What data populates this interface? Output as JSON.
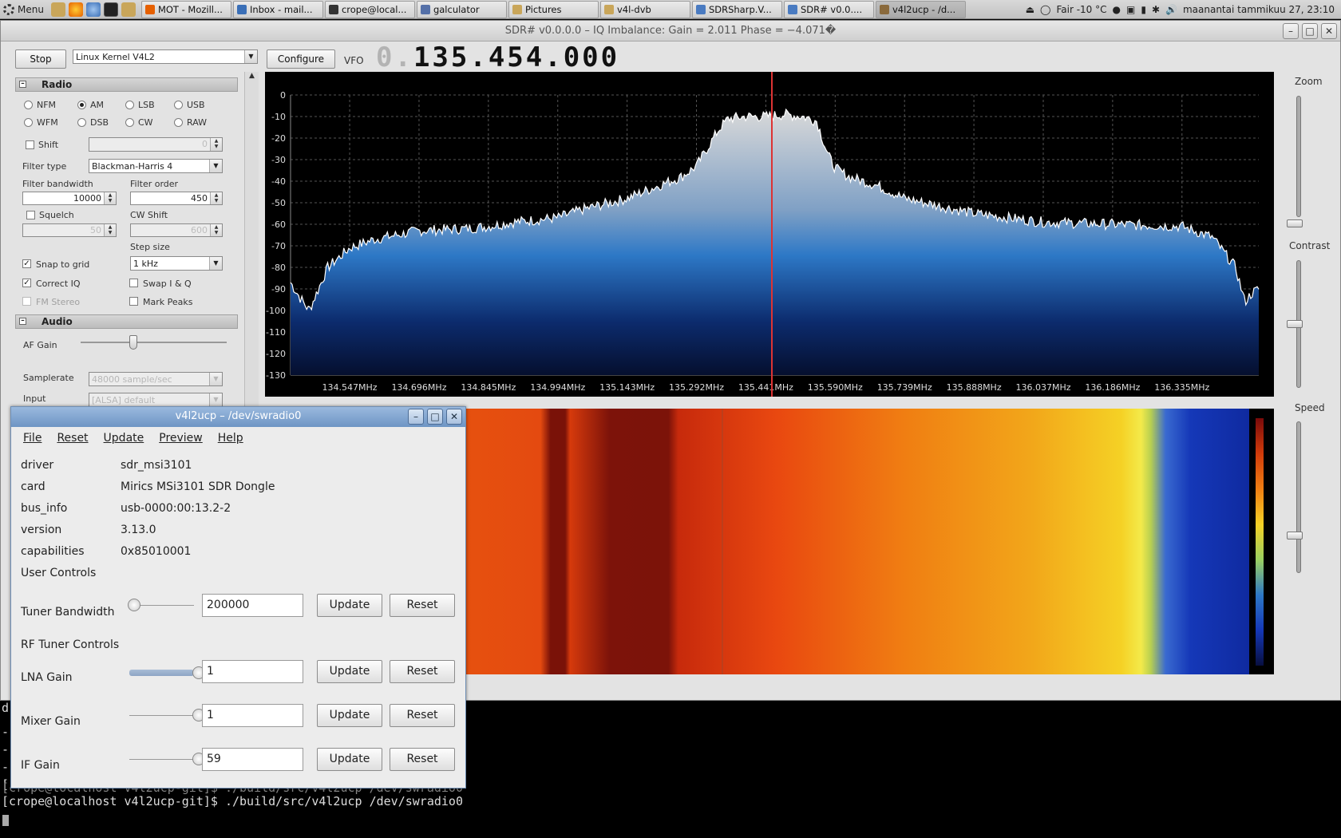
{
  "taskbar": {
    "menu_label": "Menu",
    "tasks": [
      {
        "label": "MOT - Mozill...",
        "color": "#e66000"
      },
      {
        "label": "Inbox - mail...",
        "color": "#3a6fb7"
      },
      {
        "label": "crope@local...",
        "color": "#333333"
      },
      {
        "label": "galculator",
        "color": "#5470a8"
      },
      {
        "label": "Pictures",
        "color": "#c9a65a"
      },
      {
        "label": "v4l-dvb",
        "color": "#c9a65a"
      },
      {
        "label": "SDRSharp.V...",
        "color": "#4a7bc1"
      },
      {
        "label": "SDR# v0.0....",
        "color": "#4a7bc1"
      },
      {
        "label": "v4l2ucp - /d...",
        "color": "#8a6a3c"
      }
    ],
    "weather": "Fair -10 °C",
    "clock": "maanantai tammikuu 27, 23:10"
  },
  "sdr": {
    "title": "SDR# v0.0.0.0 – IQ Imbalance: Gain = 2.011 Phase = −4.071�",
    "stop_label": "Stop",
    "source": "Linux Kernel V4L2",
    "configure_label": "Configure",
    "vfo_label": "VFO",
    "vfo_dim": "0.",
    "vfo_value": "135.454.000",
    "radio_section": "Radio",
    "modes": [
      "NFM",
      "AM",
      "LSB",
      "USB",
      "WFM",
      "DSB",
      "CW",
      "RAW"
    ],
    "selected_mode": "AM",
    "shift_label": "Shift",
    "shift_value": "0",
    "filter_type_label": "Filter type",
    "filter_type": "Blackman-Harris 4",
    "filter_bw_label": "Filter bandwidth",
    "filter_bw": "10000",
    "filter_order_label": "Filter order",
    "filter_order": "450",
    "squelch_label": "Squelch",
    "squelch_value": "50",
    "cw_shift_label": "CW Shift",
    "cw_shift_value": "600",
    "step_size_label": "Step size",
    "step_size": "1 kHz",
    "snap_label": "Snap to grid",
    "correct_iq_label": "Correct IQ",
    "swap_iq_label": "Swap I & Q",
    "fm_stereo_label": "FM Stereo",
    "mark_peaks_label": "Mark Peaks",
    "audio_section": "Audio",
    "af_gain_label": "AF Gain",
    "samplerate_label": "Samplerate",
    "samplerate": "48000 sample/sec",
    "input_label": "Input",
    "input_value": "[ALSA] default",
    "zoom_label": "Zoom",
    "contrast_label": "Contrast",
    "speed_label": "Speed"
  },
  "chart_data": {
    "type": "area",
    "ylim": [
      -130,
      0
    ],
    "y_ticks": [
      "0",
      "-10",
      "-20",
      "-30",
      "-40",
      "-50",
      "-60",
      "-70",
      "-80",
      "-90",
      "-100",
      "-110",
      "-120",
      "-130"
    ],
    "x_ticks": [
      "134.547MHz",
      "134.696MHz",
      "134.845MHz",
      "134.994MHz",
      "135.143MHz",
      "135.292MHz",
      "135.441MHz",
      "135.590MHz",
      "135.739MHz",
      "135.888MHz",
      "136.037MHz",
      "136.186MHz",
      "136.335MHz"
    ],
    "x_mhz": [
      134.42,
      134.44,
      134.46,
      134.5,
      134.547,
      134.6,
      134.696,
      134.8,
      134.845,
      134.9,
      134.994,
      135.05,
      135.143,
      135.2,
      135.26,
      135.292,
      135.34,
      135.36,
      135.4,
      135.441,
      135.48,
      135.52,
      135.55,
      135.575,
      135.59,
      135.62,
      135.68,
      135.739,
      135.888,
      136.037,
      136.186,
      136.335,
      136.4,
      136.45,
      136.47,
      136.485,
      136.5
    ],
    "y_db": [
      -87,
      -94,
      -100,
      -80,
      -71,
      -67,
      -63,
      -62,
      -61,
      -59,
      -57,
      -53,
      -48,
      -43,
      -38,
      -33,
      -16,
      -11,
      -10,
      -10,
      -9,
      -10,
      -12,
      -28,
      -34,
      -38,
      -42,
      -48,
      -55,
      -59,
      -60,
      -61,
      -66,
      -80,
      -96,
      -92,
      -90
    ],
    "tuned_mhz": 135.454
  },
  "v4l2ucp": {
    "title": "v4l2ucp – /dev/swradio0",
    "menu": [
      "File",
      "Reset",
      "Update",
      "Preview",
      "Help"
    ],
    "info": [
      {
        "key": "driver",
        "value": "sdr_msi3101"
      },
      {
        "key": "card",
        "value": "Mirics MSi3101 SDR Dongle"
      },
      {
        "key": "bus_info",
        "value": "usb-0000:00:13.2-2"
      },
      {
        "key": "version",
        "value": "3.13.0"
      },
      {
        "key": "capabilities",
        "value": "0x85010001"
      }
    ],
    "user_controls_label": "User Controls",
    "rf_tuner_label": "RF Tuner Controls",
    "controls": [
      {
        "label": "Tuner Bandwidth",
        "value": "200000",
        "level": 0.0
      },
      {
        "label": "LNA Gain",
        "value": "1",
        "level": 1.0
      },
      {
        "label": "Mixer Gain",
        "value": "1",
        "level": 1.0
      },
      {
        "label": "IF Gain",
        "value": "59",
        "level": 1.0
      }
    ],
    "update_label": "Update",
    "reset_label": "Reset"
  },
  "terminal": {
    "lines": [
      "d",
      "-",
      "-",
      "-",
      "[",
      "[crope@localhost v4l2ucp-git]$ ./build/src/v4l2ucp /dev/swradio0",
      "[crope@localhost v4l2ucp-git]$ ./build/src/v4l2ucp /dev/swradio0"
    ]
  }
}
